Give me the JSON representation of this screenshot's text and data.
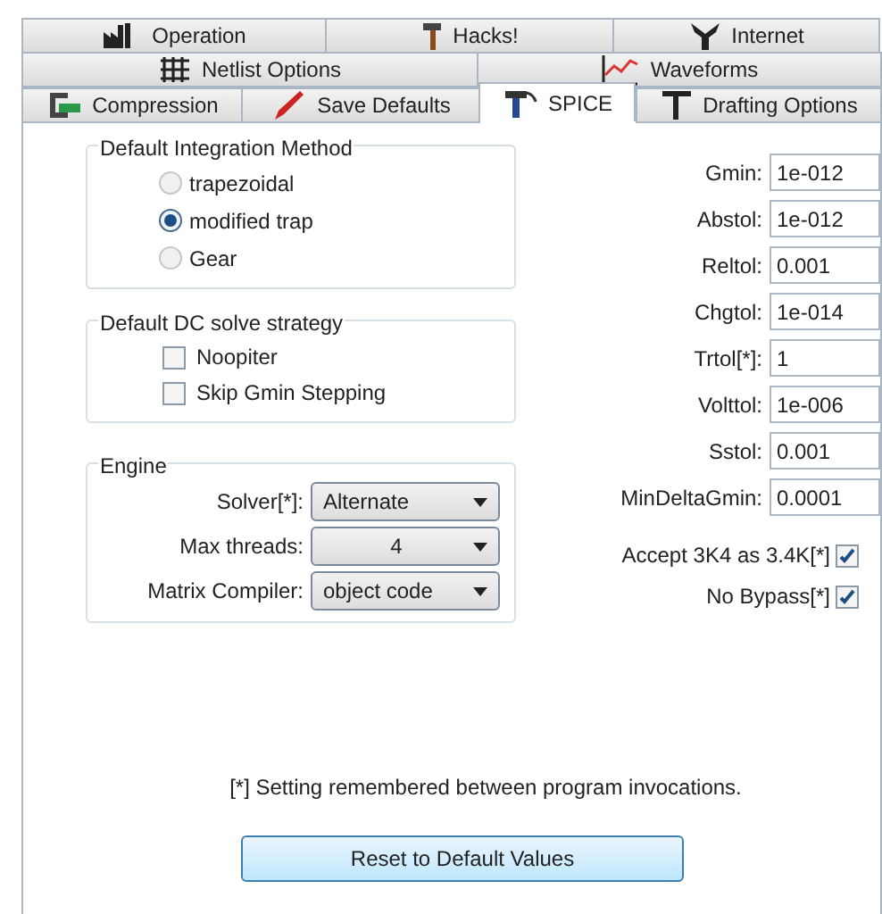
{
  "tab_rows": [
    [
      {
        "label": "Operation",
        "selected": false
      },
      {
        "label": "Hacks!",
        "selected": false
      },
      {
        "label": "Internet",
        "selected": false
      }
    ],
    [
      {
        "label": "Netlist Options",
        "selected": false
      },
      {
        "label": "Waveforms",
        "selected": false
      }
    ],
    [
      {
        "label": "Compression",
        "selected": false
      },
      {
        "label": "Save Defaults",
        "selected": false
      },
      {
        "label": "SPICE",
        "selected": true
      },
      {
        "label": "Drafting Options",
        "selected": false
      }
    ]
  ],
  "integration": {
    "title": "Default Integration Method",
    "options": [
      {
        "label": "trapezoidal",
        "selected": false
      },
      {
        "label": "modified trap",
        "selected": true
      },
      {
        "label": "Gear",
        "selected": false
      }
    ]
  },
  "dc_strategy": {
    "title": "Default DC solve strategy",
    "options": [
      {
        "label": "Noopiter",
        "checked": false
      },
      {
        "label": "Skip Gmin Stepping",
        "checked": false
      }
    ]
  },
  "engine": {
    "title": "Engine",
    "dropdowns": [
      {
        "label": "Solver[*]:",
        "value": "Alternate"
      },
      {
        "label": "Max threads:",
        "value": "4"
      },
      {
        "label": "Matrix Compiler:",
        "value": "object code"
      }
    ]
  },
  "tolerances": [
    {
      "label": "Gmin:",
      "value": "1e-012"
    },
    {
      "label": "Abstol:",
      "value": "1e-012"
    },
    {
      "label": "Reltol:",
      "value": "0.001"
    },
    {
      "label": "Chgtol:",
      "value": "1e-014"
    },
    {
      "label": "Trtol[*]:",
      "value": "1"
    },
    {
      "label": "Volttol:",
      "value": "1e-006"
    },
    {
      "label": "Sstol:",
      "value": "0.001"
    },
    {
      "label": "MinDeltaGmin:",
      "value": "0.0001"
    }
  ],
  "options": [
    {
      "label": "Accept 3K4 as 3.4K[*]",
      "checked": true
    },
    {
      "label": "No Bypass[*]",
      "checked": true
    }
  ],
  "note": "[*] Setting remembered between program invocations.",
  "reset_button": "Reset to Default Values"
}
